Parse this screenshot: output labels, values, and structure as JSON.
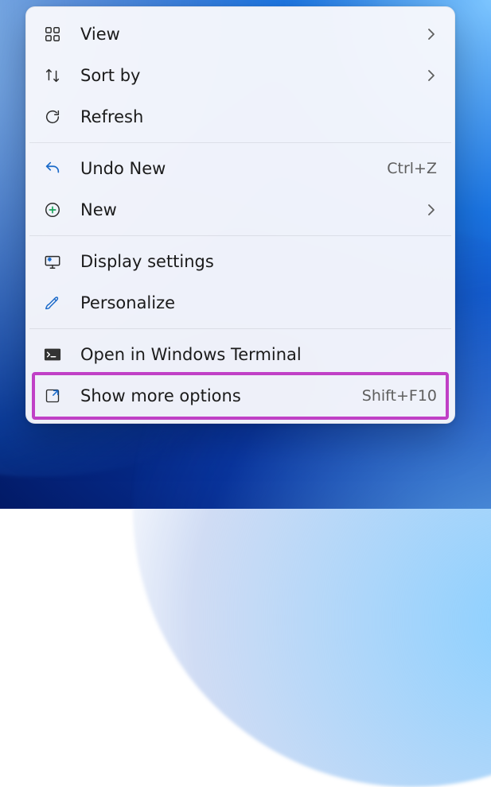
{
  "menu": {
    "groups": [
      [
        {
          "id": "view",
          "label": "View",
          "icon": "grid",
          "submenu": true
        },
        {
          "id": "sortby",
          "label": "Sort by",
          "icon": "sort",
          "submenu": true
        },
        {
          "id": "refresh",
          "label": "Refresh",
          "icon": "refresh"
        }
      ],
      [
        {
          "id": "undo",
          "label": "Undo New",
          "icon": "undo",
          "shortcut": "Ctrl+Z"
        },
        {
          "id": "new",
          "label": "New",
          "icon": "plus-circle",
          "submenu": true
        }
      ],
      [
        {
          "id": "display",
          "label": "Display settings",
          "icon": "display-gear"
        },
        {
          "id": "personalize",
          "label": "Personalize",
          "icon": "brush"
        }
      ],
      [
        {
          "id": "terminal",
          "label": "Open in Windows Terminal",
          "icon": "terminal"
        },
        {
          "id": "more",
          "label": "Show more options",
          "icon": "expand",
          "shortcut": "Shift+F10",
          "highlighted": true
        }
      ]
    ]
  }
}
